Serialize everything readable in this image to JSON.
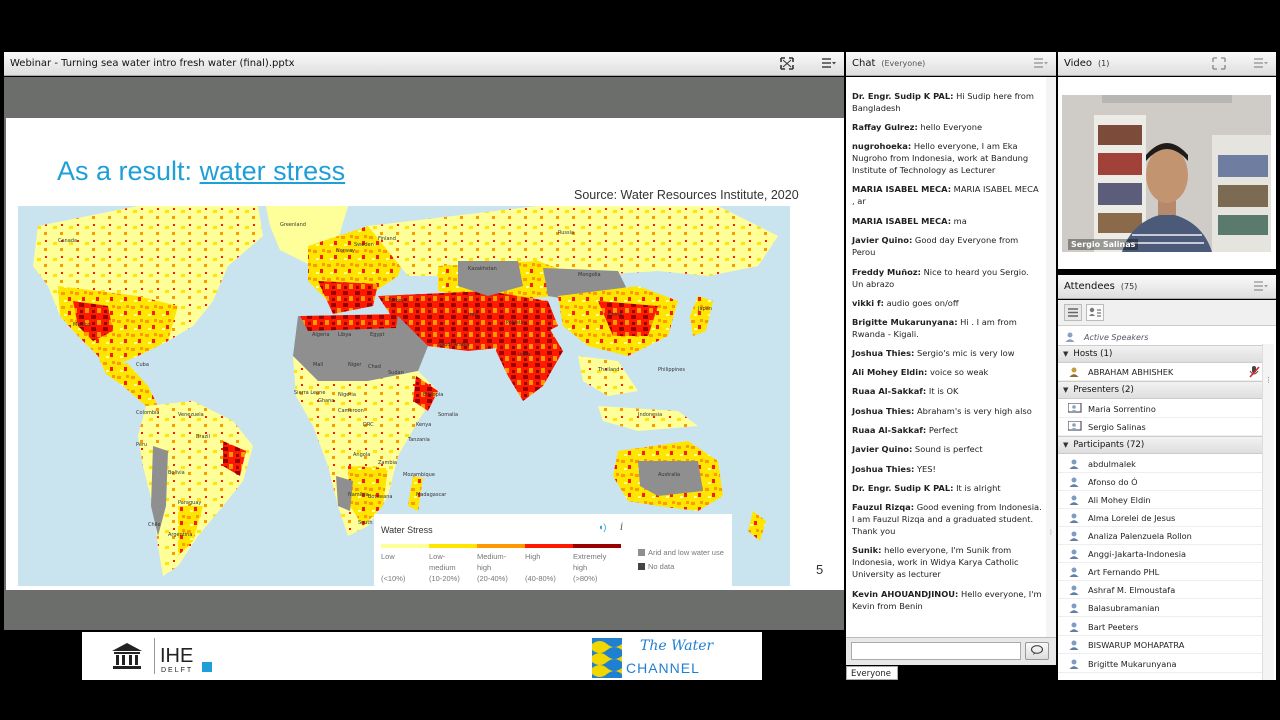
{
  "share": {
    "title": "Webinar - Turning sea water intro fresh water (final).pptx"
  },
  "slide": {
    "title_plain": "As a result: ",
    "title_link": "water stress",
    "source": "Source: Water Resources Institute, 2020",
    "page_number": "5",
    "legend": {
      "title": "Water Stress",
      "levels": [
        {
          "label": "Low",
          "range": "(<10%)",
          "color": "#ffff99"
        },
        {
          "label": "Low-medium",
          "range": "(10-20%)",
          "color": "#ffe600"
        },
        {
          "label": "Medium-high",
          "range": "(20-40%)",
          "color": "#ff9900"
        },
        {
          "label": "High",
          "range": "(40-80%)",
          "color": "#ff1900"
        },
        {
          "label": "Extremely high",
          "range": "(>80%)",
          "color": "#990000"
        }
      ],
      "arid": "Arid and low water use",
      "nodata": "No data"
    },
    "map_labels": [
      "Canada",
      "Mexico",
      "Colombia",
      "Brazil",
      "Peru",
      "Bolivia",
      "Paraguay",
      "Argentina",
      "Chile",
      "Greenland",
      "Norway",
      "Sweden",
      "Finland",
      "Russia",
      "Kazakhstan",
      "Mongolia",
      "China",
      "Japan",
      "India",
      "Iran",
      "Turkey",
      "Egypt",
      "Libya",
      "Algeria",
      "Mali",
      "Niger",
      "Chad",
      "Sudan",
      "Ethiopia",
      "Kenya",
      "DRC",
      "Nigeria",
      "Angola",
      "Zambia",
      "Namibia",
      "Botswana",
      "South Africa",
      "Madagascar",
      "Indonesia",
      "Australia",
      "Saudi Arabia",
      "Pakistan",
      "Thailand",
      "Philippines",
      "Cuba",
      "Venezuela",
      "Sierra Leone",
      "Ghana",
      "Cameroon",
      "Somalia",
      "Tanzania",
      "Mozambique"
    ]
  },
  "chat": {
    "title": "Chat",
    "scope": "(Everyone)",
    "tab": "Everyone",
    "messages": [
      {
        "from": "Dr. Engr. Sudip K PAL:",
        "text": "Hi Sudip here from Bangladesh"
      },
      {
        "from": "Raffay Gulrez:",
        "text": "hello Everyone"
      },
      {
        "from": "nugrohoeka:",
        "text": "Hello everyone, I am Eka Nugroho from Indonesia, work at Bandung Institute of Technology as Lecturer"
      },
      {
        "from": "MARIA ISABEL MECA:",
        "text": "MARIA ISABEL MECA , ar"
      },
      {
        "from": "MARIA ISABEL MECA:",
        "text": "ma"
      },
      {
        "from": "Javier Quino:",
        "text": "Good day Everyone from Perou"
      },
      {
        "from": "Freddy Muñoz:",
        "text": "Nice to heard you Sergio. Un abrazo"
      },
      {
        "from": "vikki f:",
        "text": "audio goes on/off"
      },
      {
        "from": "Brigitte Mukarunyana:",
        "text": "Hi . I am from Rwanda - Kigali."
      },
      {
        "from": "Joshua Thies:",
        "text": "Sergio's mic is very low"
      },
      {
        "from": "Ali Mohey Eldin:",
        "text": "voice so weak"
      },
      {
        "from": "Ruaa Al-Sakkaf:",
        "text": "It is OK"
      },
      {
        "from": "Joshua Thies:",
        "text": "Abraham's is very high also"
      },
      {
        "from": "Ruaa Al-Sakkaf:",
        "text": "Perfect"
      },
      {
        "from": "Javier Quino:",
        "text": "Sound is perfect"
      },
      {
        "from": "Joshua Thies:",
        "text": "YES!"
      },
      {
        "from": "Dr. Engr. Sudip K PAL:",
        "text": "It is alright"
      },
      {
        "from": "Fauzul Rizqa:",
        "text": "Good evening from Indonesia. I am Fauzul Rizqa and a graduated student. Thank you"
      },
      {
        "from": "Sunik:",
        "text": "hello everyone, I'm Sunik from Indonesia, work in Widya Karya Catholic University as lecturer"
      },
      {
        "from": "Kevin AHOUANDJINOU:",
        "text": "Hello everyone, I'm Kevin from Benin"
      }
    ]
  },
  "video": {
    "title": "Video",
    "count": "(1)",
    "speaker": "Sergio Salinas"
  },
  "attendees": {
    "title": "Attendees",
    "count": "(75)",
    "active_speakers": "Active Speakers",
    "hosts_label": "Hosts (1)",
    "hosts": [
      "ABRAHAM ABHISHEK"
    ],
    "presenters_label": "Presenters (2)",
    "presenters": [
      "Maria Sorrentino",
      "Sergio Salinas"
    ],
    "participants_label": "Participants (72)",
    "participants": [
      "abdulmalek",
      "Afonso do Ó",
      "Ali Mohey Eldin",
      "Alma Lorelei de Jesus",
      "Analiza Palenzuela Rollon",
      "Anggi-Jakarta-Indonesia",
      "Art Fernando PHL",
      "Ashraf M. Elmoustafa",
      "Balasubramanian",
      "Bart Peeters",
      "BISWARUP MOHAPATRA",
      "Brigitte Mukarunyana"
    ]
  },
  "banner": {
    "unesco": "UNESCO",
    "ihe": "IHE",
    "delft": "DELFT",
    "channel_top": "The Water",
    "channel_bottom": "CHANNEL"
  }
}
